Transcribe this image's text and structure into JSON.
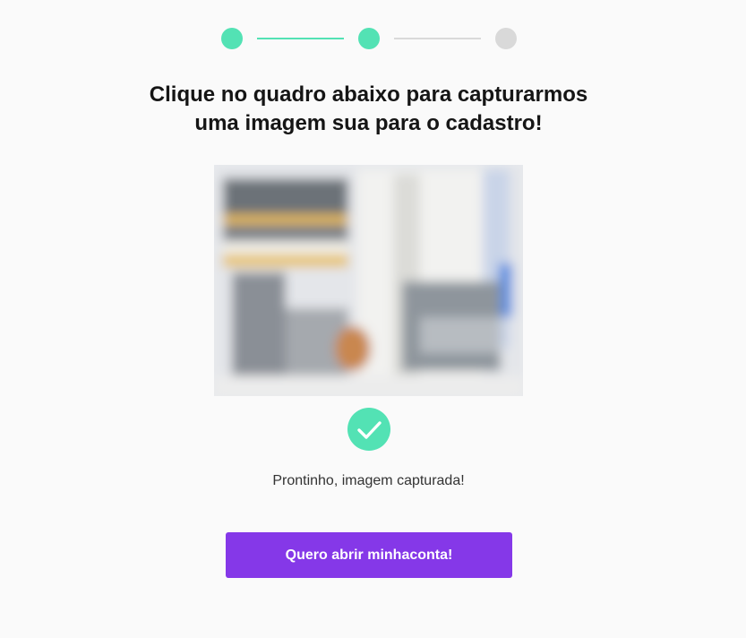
{
  "stepper": {
    "total_steps": 3,
    "current_step": 2,
    "colors": {
      "done": "#53e2b4",
      "pending": "#d9d9d9"
    }
  },
  "heading": {
    "line1": "Clique no quadro abaixo para capturarmos",
    "line2": "uma imagem sua para o cadastro!"
  },
  "capture": {
    "state": "captured",
    "icon": "check-circle-icon"
  },
  "status": {
    "text": "Prontinho, imagem capturada!"
  },
  "cta": {
    "label": "Quero abrir minhaconta!",
    "color": "#8538e8"
  },
  "colors": {
    "background": "#fafafa",
    "accent": "#53e2b4",
    "text": "#151515"
  }
}
